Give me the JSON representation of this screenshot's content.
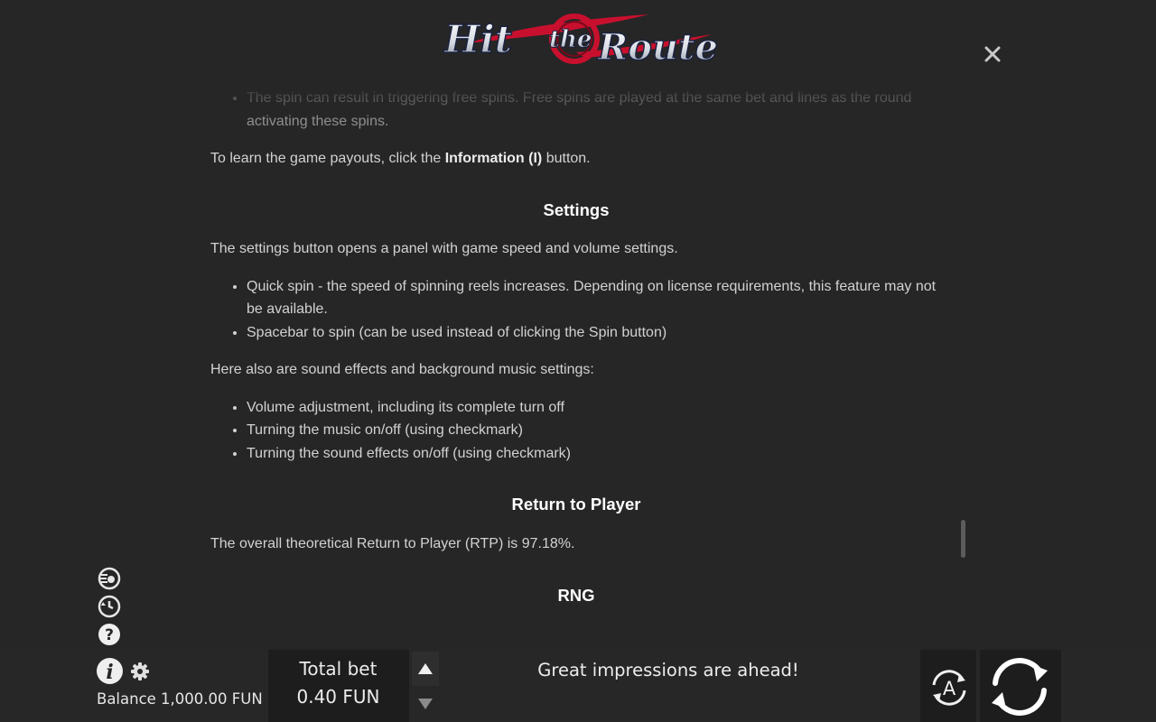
{
  "logo": {
    "text_hit": "Hit",
    "text_the": "the",
    "text_route": "Route"
  },
  "rules": {
    "faded_bullet": "The spin can result in triggering free spins. Free spins are played at the same bet and lines as the round activating these spins.",
    "payouts_prefix": "To learn the game payouts, click the ",
    "payouts_bold": "Information (I)",
    "payouts_suffix": " button.",
    "settings_heading": "Settings",
    "settings_intro": "The settings button opens a panel with game speed and volume settings.",
    "settings_items": [
      "Quick spin - the speed of spinning reels increases. Depending on license requirements, this feature may not be available.",
      "Spacebar to spin (can be used instead of clicking the Spin button)"
    ],
    "sound_intro": "Here also are sound effects and background music settings:",
    "sound_items": [
      "Volume adjustment, including its complete turn off",
      "Turning the music on/off (using checkmark)",
      "Turning the sound effects on/off (using checkmark)"
    ],
    "rtp_heading": "Return to Player",
    "rtp_text": "The overall theoretical Return to Player (RTP) is 97.18%.",
    "rng_heading": "RNG"
  },
  "icons": {
    "close": "close-icon",
    "quick_spin": "quick-spin-icon",
    "history": "history-icon",
    "help": "help-icon",
    "info": "info-icon",
    "settings": "gear-icon",
    "bet_up": "triangle-up-icon",
    "bet_down": "triangle-down-icon",
    "auto": "autoplay-icon",
    "spin": "spin-icon"
  },
  "bottom_bar": {
    "balance": "Balance 1,000.00 FUN",
    "total_bet_label": "Total bet",
    "total_bet_value": "0.40 FUN",
    "message": "Great impressions are ahead!",
    "auto_label": "A"
  },
  "colors": {
    "background": "#262626",
    "bar": "#272727",
    "panel": "#1d1d1d",
    "logo_red": "#c8102e",
    "text": "#d2d2d2"
  }
}
